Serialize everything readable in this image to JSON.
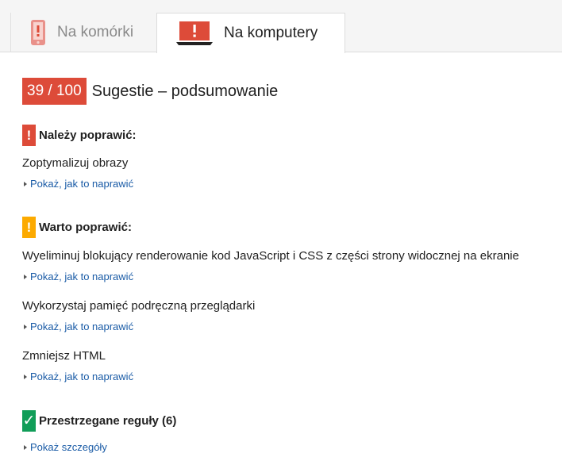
{
  "tabs": [
    {
      "label": "Na komórki",
      "icon": "mobile-phone-icon"
    },
    {
      "label": "Na komputery",
      "icon": "laptop-icon"
    }
  ],
  "summary": {
    "score": "39 / 100",
    "title": "Sugestie – podsumowanie",
    "score_color": "#dd4b39"
  },
  "sections": {
    "must_fix": {
      "mark": "!",
      "heading": "Należy poprawić:",
      "color": "#dd4b39",
      "rules": [
        {
          "title": "Zoptymalizuj obrazy",
          "link": "Pokaż, jak to naprawić"
        }
      ]
    },
    "consider_fixing": {
      "mark": "!",
      "heading": "Warto poprawić:",
      "color": "#fcaa00",
      "rules": [
        {
          "title": "Wyeliminuj blokujący renderowanie kod JavaScript i CSS z części strony widocznej na ekranie",
          "link": "Pokaż, jak to naprawić"
        },
        {
          "title": "Wykorzystaj pamięć podręczną przeglądarki",
          "link": "Pokaż, jak to naprawić"
        },
        {
          "title": "Zmniejsz HTML",
          "link": "Pokaż, jak to naprawić"
        }
      ]
    },
    "passed": {
      "mark": "✓",
      "heading": "Przestrzegane reguły (6)",
      "color": "#109d58",
      "link": "Pokaż szczegóły"
    }
  },
  "colors": {
    "link": "#1a5ba6",
    "tab_background": "#f5f5f5"
  }
}
